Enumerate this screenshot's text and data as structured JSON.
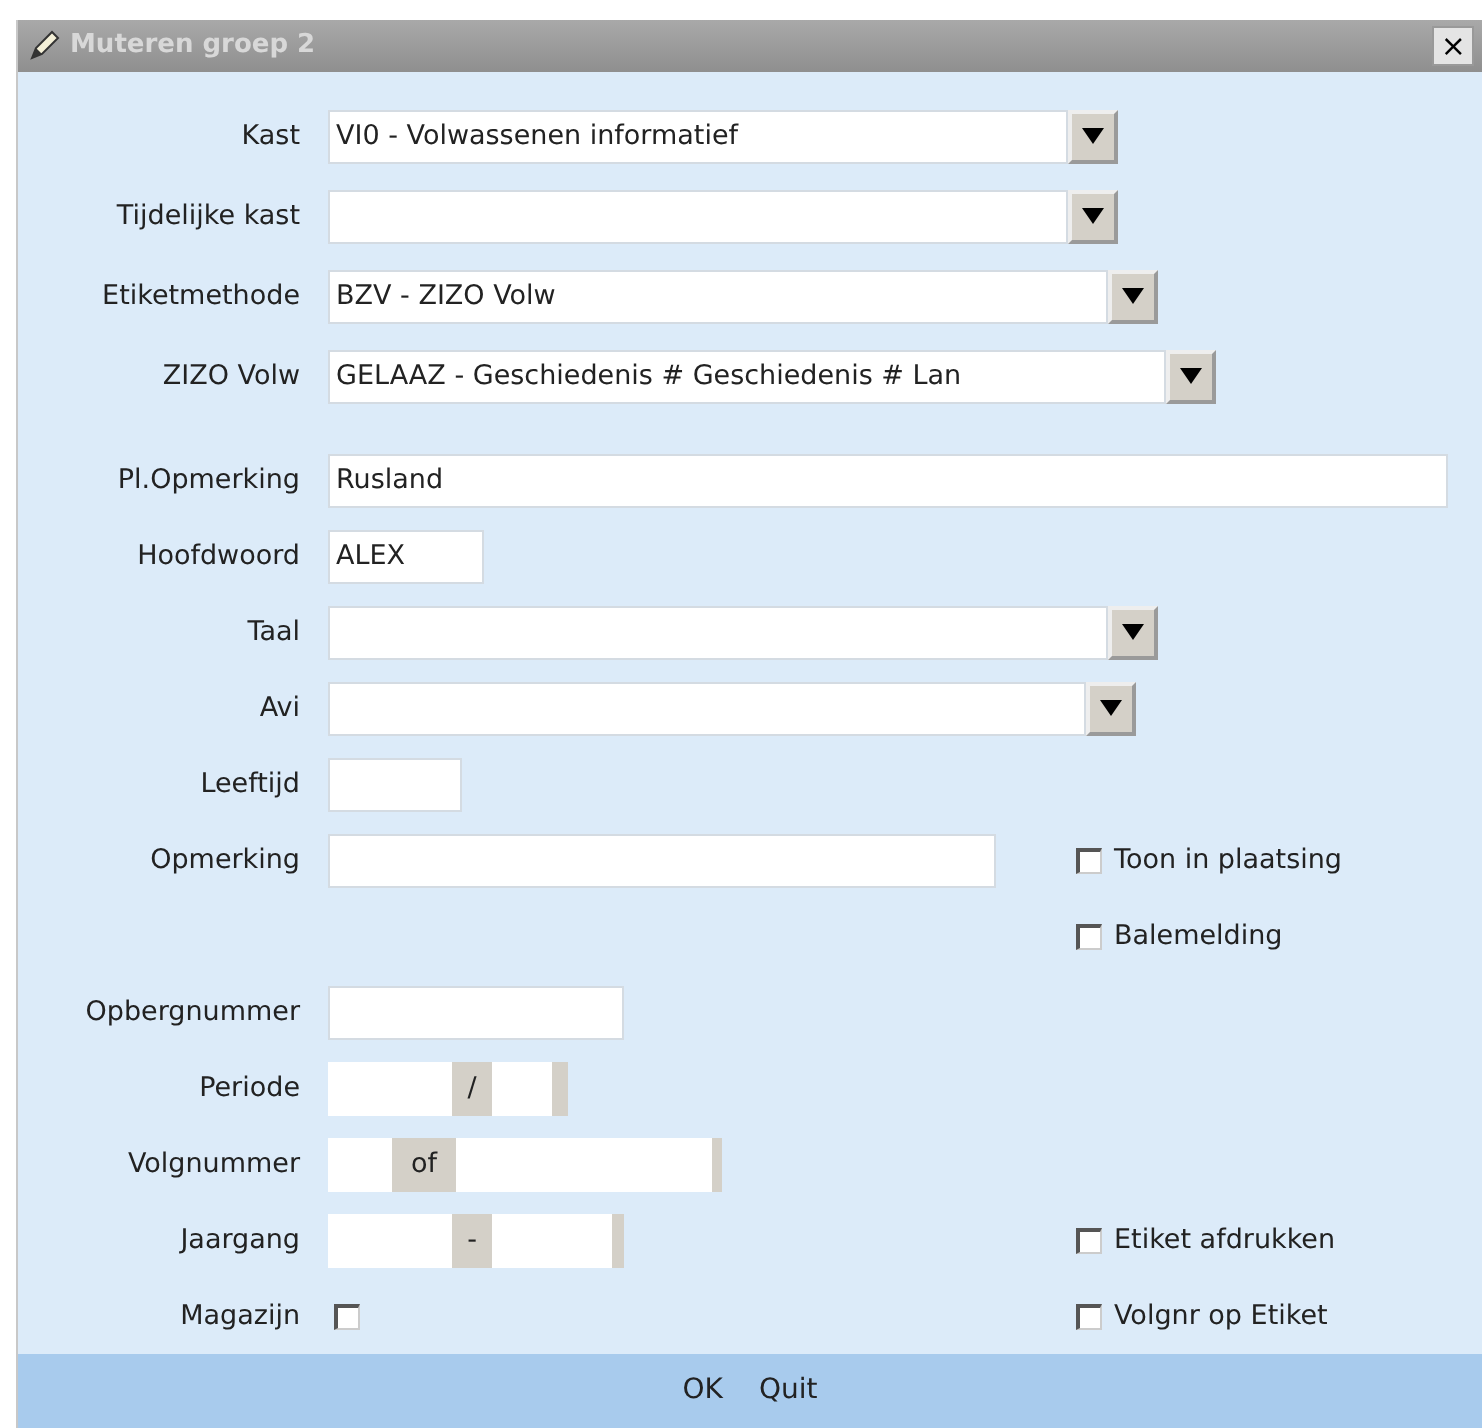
{
  "window": {
    "title": "Muteren groep 2",
    "close": "×"
  },
  "rows": [
    {
      "label": "Kast",
      "field": {
        "kind": "dropdown",
        "value": "VI0 - Volwassenen informatief"
      }
    },
    {
      "label": "Tijdelijke kast",
      "field": {
        "kind": "dropdown"
      }
    },
    {
      "label": "Etiketmethode",
      "field": {
        "kind": "dropdown",
        "value": "BZV - ZIZO Volw"
      }
    },
    {
      "label": "ZIZO Volw",
      "field": {
        "kind": "dropdown",
        "value": "GELAAZ - Geschiedenis # Geschiedenis # Lan"
      }
    },
    {
      "label": "Pl.Opmerking",
      "field": {
        "kind": "text",
        "value": "Rusland"
      }
    },
    {
      "label": "Hoofdwoord",
      "field": {
        "kind": "text",
        "value": "ALEX"
      }
    },
    {
      "label": "Taal",
      "field": {
        "kind": "dropdown"
      }
    },
    {
      "label": "Avi",
      "field": {
        "kind": "dropdown"
      }
    },
    {
      "label": "Leeftijd",
      "field": {
        "kind": "text"
      }
    },
    {
      "label": "Opmerking",
      "field": {
        "kind": "text"
      },
      "option": {
        "label": "Toon in plaatsing",
        "checked": false
      }
    },
    {
      "option": {
        "label": "Balemelding",
        "checked": false
      }
    },
    {
      "label": "Opbergnummer",
      "field": {
        "kind": "text"
      }
    },
    {
      "label": "Periode",
      "field": {
        "kind": "pair",
        "separator": "/"
      }
    },
    {
      "label": "Volgnummer",
      "field": {
        "kind": "pair",
        "separator": "of"
      }
    },
    {
      "label": "Jaargang",
      "field": {
        "kind": "pair",
        "separator": "-"
      },
      "option": {
        "label": "Etiket afdrukken",
        "checked": false
      }
    },
    {
      "label": "Magazijn",
      "field": {
        "kind": "checkbox",
        "checked": false
      },
      "option": {
        "label": "Volgnr op Etiket",
        "checked": false
      }
    }
  ],
  "buttons": [
    "OK",
    "Quit"
  ]
}
